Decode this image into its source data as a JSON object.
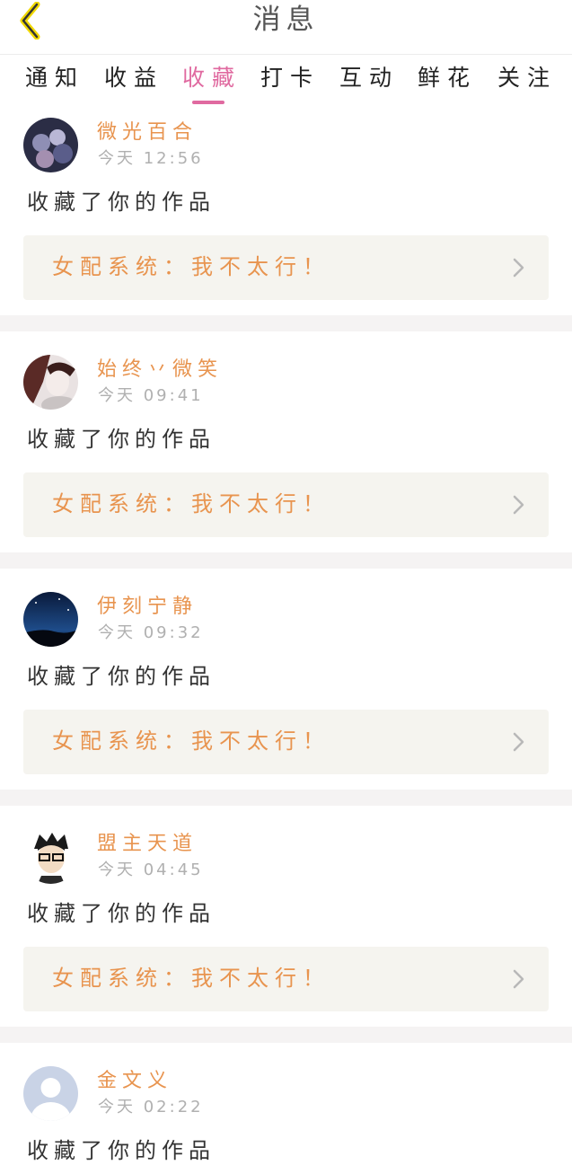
{
  "header": {
    "title": "消息",
    "back_icon": "chevron-left-icon",
    "back_icon_color": "#f1d800"
  },
  "tabs": [
    {
      "label": "通知"
    },
    {
      "label": "收益"
    },
    {
      "label": "收藏",
      "active": true
    },
    {
      "label": "打卡"
    },
    {
      "label": "互动"
    },
    {
      "label": "鲜花"
    },
    {
      "label": "关注"
    }
  ],
  "colors": {
    "accent": "#e06aa0",
    "name": "#e8944f",
    "time": "#b0b0b0",
    "card_bg": "#f5f4ef"
  },
  "items": [
    {
      "name": "微光百合",
      "time": "今天 12:56",
      "action": "收藏了你的作品",
      "work": "女配系统：我不太行！",
      "avatar": "avatar-group-icon"
    },
    {
      "name": "始终丷微笑",
      "time": "今天 09:41",
      "action": "收藏了你的作品",
      "work": "女配系统：我不太行！",
      "avatar": "avatar-girl-icon"
    },
    {
      "name": "伊刻宁静",
      "time": "今天 09:32",
      "action": "收藏了你的作品",
      "work": "女配系统：我不太行！",
      "avatar": "avatar-night-sky-icon"
    },
    {
      "name": "盟主天道",
      "time": "今天 04:45",
      "action": "收藏了你的作品",
      "work": "女配系统：我不太行！",
      "avatar": "avatar-cartoon-boy-icon"
    },
    {
      "name": "金文义",
      "time": "今天 02:22",
      "action": "收藏了你的作品",
      "work": "",
      "avatar": "avatar-default-icon"
    }
  ]
}
